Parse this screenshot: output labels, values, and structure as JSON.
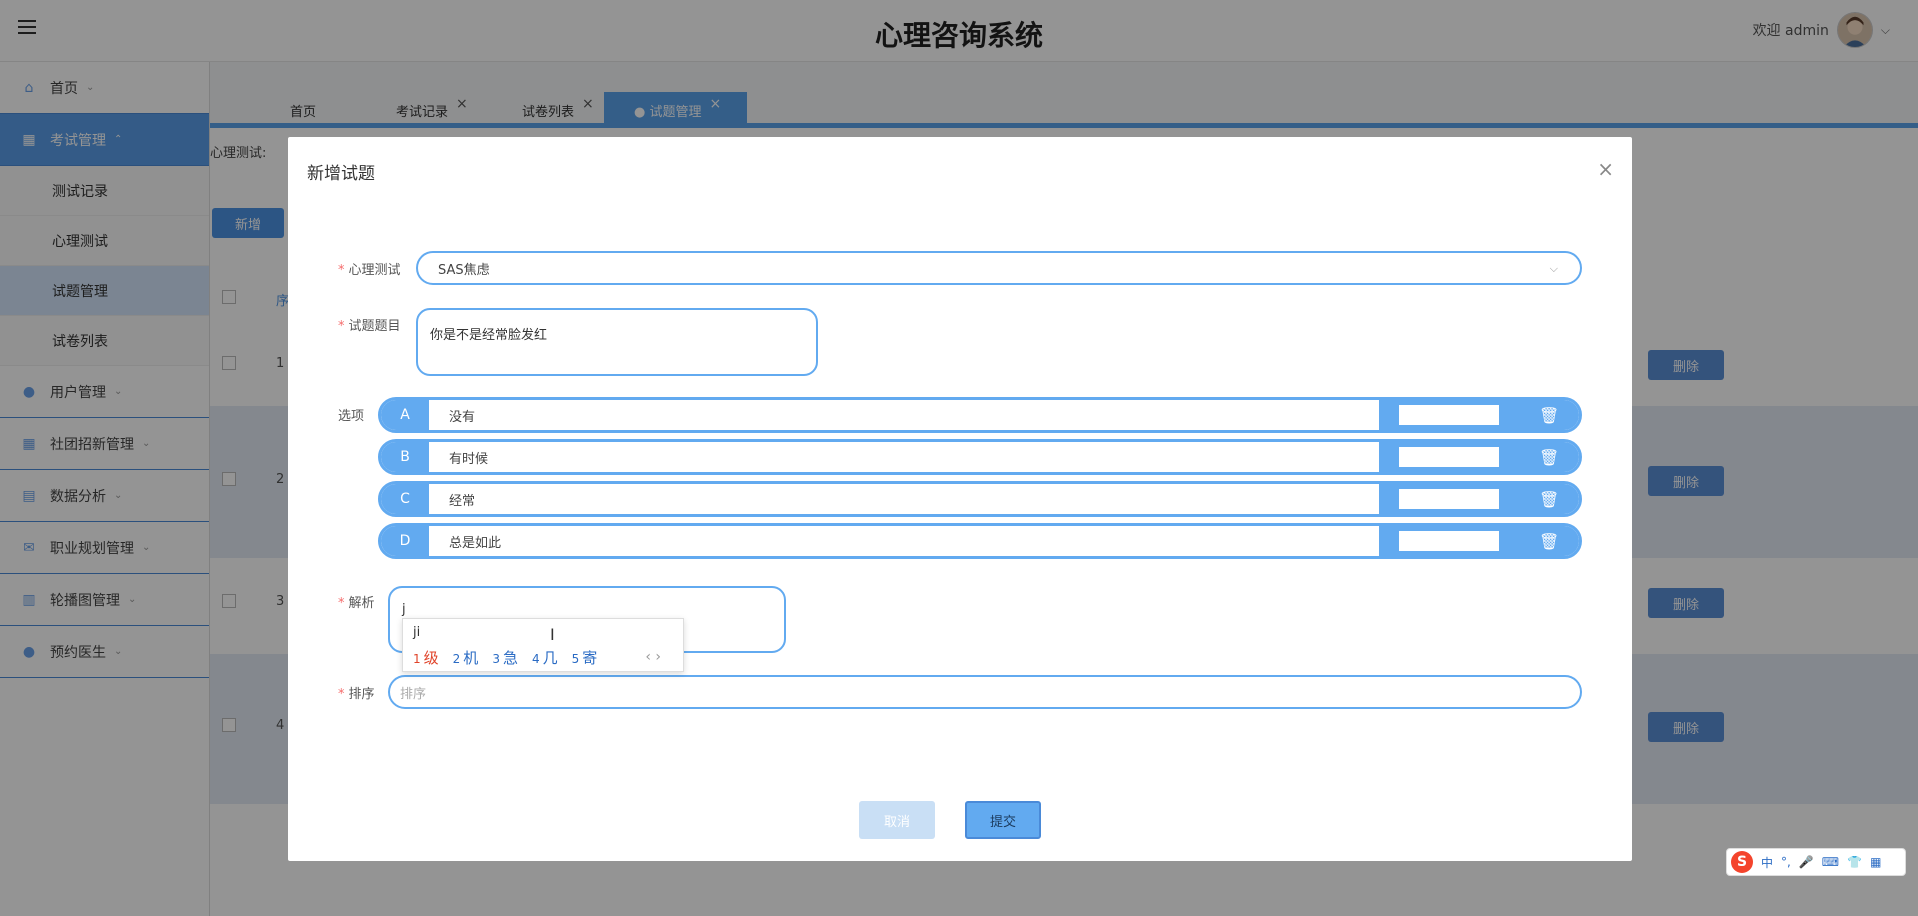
{
  "header": {
    "title": "心理咨询系统",
    "welcome": "欢迎 admin"
  },
  "sidebar": {
    "items": [
      {
        "label": "首页"
      },
      {
        "label": "考试管理"
      },
      {
        "label": "用户管理"
      },
      {
        "label": "社团招新管理"
      },
      {
        "label": "数据分析"
      },
      {
        "label": "职业规划管理"
      },
      {
        "label": "轮播图管理"
      },
      {
        "label": "预约医生"
      }
    ],
    "subitems": [
      {
        "label": "测试记录"
      },
      {
        "label": "心理测试"
      },
      {
        "label": "试题管理"
      },
      {
        "label": "试卷列表"
      }
    ]
  },
  "tabs": [
    {
      "label": "首页"
    },
    {
      "label": "考试记录"
    },
    {
      "label": "试卷列表"
    },
    {
      "label": "● 试题管理"
    }
  ],
  "page": {
    "filter_label": "心理测试:",
    "add_label": "新增",
    "header_col": "序",
    "rows": [
      "1",
      "2",
      "3",
      "4"
    ],
    "delete_label": "删除"
  },
  "modal": {
    "title": "新增试题",
    "test_label": "心理测试",
    "test_value": "SAS焦虑",
    "question_label": "试题题目",
    "question_value": "你是不是经常脸发红",
    "options_label": "选项",
    "options": [
      {
        "key": "A",
        "text": "没有"
      },
      {
        "key": "B",
        "text": "有时候"
      },
      {
        "key": "C",
        "text": "经常"
      },
      {
        "key": "D",
        "text": "总是如此"
      }
    ],
    "analysis_label": "解析",
    "analysis_value": "j",
    "order_label": "排序",
    "order_placeholder": "排序",
    "cancel": "取消",
    "submit": "提交"
  },
  "ime": {
    "input": "ji",
    "candidates": [
      {
        "n": "1",
        "text": "级"
      },
      {
        "n": "2",
        "text": "机"
      },
      {
        "n": "3",
        "text": "急"
      },
      {
        "n": "4",
        "text": "几"
      },
      {
        "n": "5",
        "text": "寄"
      }
    ],
    "toolbar_lang": "中"
  },
  "colors": {
    "accent": "#62aaf0",
    "sidebar_active": "#5a9ee8",
    "required": "#f56c6c"
  }
}
